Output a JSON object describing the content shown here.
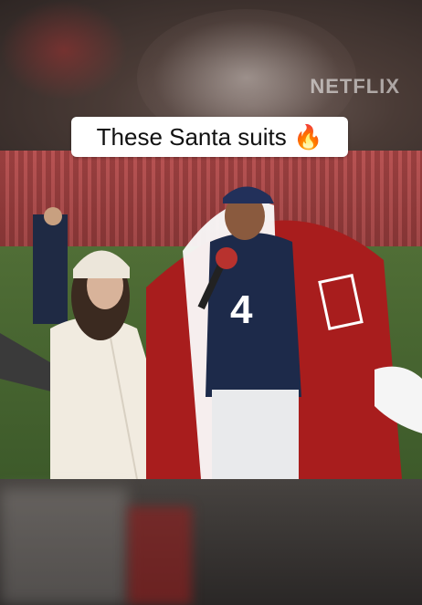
{
  "caption": {
    "text": "These Santa suits 🔥"
  },
  "watermark": {
    "text": "NETFLIX"
  },
  "jersey": {
    "number": "4"
  }
}
